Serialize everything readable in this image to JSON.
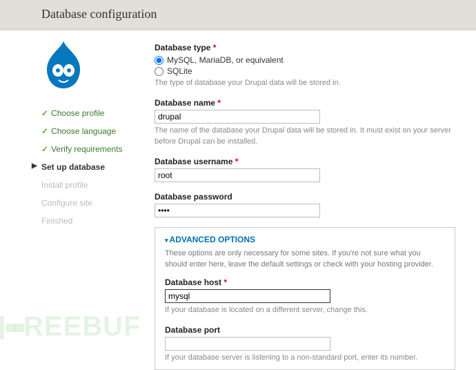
{
  "header": {
    "title": "Database configuration"
  },
  "sidebar": {
    "steps": [
      {
        "label": "Choose profile",
        "state": "done"
      },
      {
        "label": "Choose language",
        "state": "done"
      },
      {
        "label": "Verify requirements",
        "state": "done"
      },
      {
        "label": "Set up database",
        "state": "active"
      },
      {
        "label": "Install profile",
        "state": "pending"
      },
      {
        "label": "Configure site",
        "state": "pending"
      },
      {
        "label": "Finished",
        "state": "pending"
      }
    ]
  },
  "form": {
    "db_type": {
      "label": "Database type",
      "required": "*",
      "options": [
        {
          "label": "MySQL, MariaDB, or equivalent",
          "checked": true
        },
        {
          "label": "SQLite",
          "checked": false
        }
      ],
      "desc": "The type of database your Drupal data will be stored in."
    },
    "db_name": {
      "label": "Database name",
      "required": "*",
      "value": "drupal",
      "desc": "The name of the database your Drupal data will be stored in. It must exist on your server before Drupal can be installed."
    },
    "db_user": {
      "label": "Database username",
      "required": "*",
      "value": "root"
    },
    "db_pass": {
      "label": "Database password",
      "value": "••••"
    },
    "advanced": {
      "title": "ADVANCED OPTIONS",
      "desc": "These options are only necessary for some sites. If you're not sure what you should enter here, leave the default settings or check with your hosting provider.",
      "host": {
        "label": "Database host",
        "required": "*",
        "value": "mysql",
        "desc": "If your database is located on a different server, change this."
      },
      "port": {
        "label": "Database port",
        "value": "",
        "desc": "If your database server is listening to a non-standard port, enter its number."
      }
    }
  },
  "watermark": "REEBUF"
}
